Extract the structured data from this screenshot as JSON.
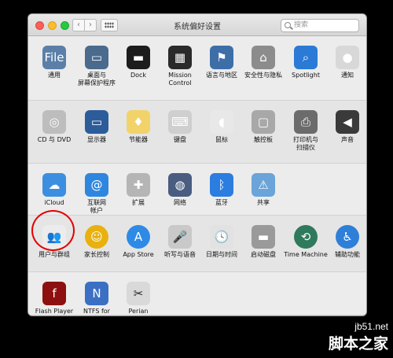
{
  "window": {
    "title": "系统偏好设置",
    "search_placeholder": "搜索",
    "nav_back": "‹",
    "nav_forward": "›"
  },
  "rows": [
    {
      "panes": [
        {
          "name": "pane-general",
          "label": "通用",
          "icon": "general-icon",
          "bg": "#5b7fa8",
          "glyph": "File"
        },
        {
          "name": "pane-desktop",
          "label": "桌面与",
          "label2": "屏幕保护程序",
          "icon": "desktop-icon",
          "bg": "#4a6a8e",
          "glyph": "▭"
        },
        {
          "name": "pane-dock",
          "label": "Dock",
          "icon": "dock-icon",
          "bg": "#1c1c1c",
          "glyph": "▬"
        },
        {
          "name": "pane-mission-control",
          "label": "Mission",
          "label2": "Control",
          "icon": "mission-control-icon",
          "bg": "#2a2a2a",
          "glyph": "▦"
        },
        {
          "name": "pane-language",
          "label": "语言与地区",
          "icon": "flag-icon",
          "bg": "#3d6ea8",
          "glyph": "⚑"
        },
        {
          "name": "pane-security",
          "label": "安全性与隐私",
          "icon": "house-lock-icon",
          "bg": "#8c8c8c",
          "glyph": "⌂"
        },
        {
          "name": "pane-spotlight",
          "label": "Spotlight",
          "icon": "spotlight-icon",
          "bg": "#2a7ad6",
          "glyph": "⌕"
        },
        {
          "name": "pane-notifications",
          "label": "通知",
          "icon": "notifications-icon",
          "bg": "#d8d8d8",
          "glyph": "●"
        }
      ]
    },
    {
      "panes": [
        {
          "name": "pane-cd-dvd",
          "label": "CD 与 DVD",
          "icon": "disc-icon",
          "bg": "#bdbdbd",
          "glyph": "◎"
        },
        {
          "name": "pane-displays",
          "label": "显示器",
          "icon": "display-icon",
          "bg": "#2c5d9a",
          "glyph": "▭"
        },
        {
          "name": "pane-energy",
          "label": "节能器",
          "icon": "lightbulb-icon",
          "bg": "#f1d36a",
          "glyph": "♦"
        },
        {
          "name": "pane-keyboard",
          "label": "键盘",
          "icon": "keyboard-icon",
          "bg": "#cfcfcf",
          "glyph": "⌨"
        },
        {
          "name": "pane-mouse",
          "label": "鼠标",
          "icon": "mouse-icon",
          "bg": "#e8e8e8",
          "glyph": "◖"
        },
        {
          "name": "pane-trackpad",
          "label": "触控板",
          "icon": "trackpad-icon",
          "bg": "#a8a8a8",
          "glyph": "▢"
        },
        {
          "name": "pane-printers",
          "label": "打印机与",
          "label2": "扫描仪",
          "icon": "printer-icon",
          "bg": "#6b6b6b",
          "glyph": "⎙"
        },
        {
          "name": "pane-sound",
          "label": "声音",
          "icon": "speaker-icon",
          "bg": "#3a3a3a",
          "glyph": "◀"
        }
      ]
    },
    {
      "panes": [
        {
          "name": "pane-icloud",
          "label": "iCloud",
          "icon": "cloud-icon",
          "bg": "#3c8fe0",
          "glyph": "☁"
        },
        {
          "name": "pane-internet-accounts",
          "label": "互联网",
          "label2": "帐户",
          "icon": "at-icon",
          "bg": "#2f86de",
          "glyph": "@"
        },
        {
          "name": "pane-extensions",
          "label": "扩展",
          "icon": "puzzle-icon",
          "bg": "#b5b5b5",
          "glyph": "✚"
        },
        {
          "name": "pane-network",
          "label": "网络",
          "icon": "globe-icon",
          "bg": "#4a5c80",
          "glyph": "◍"
        },
        {
          "name": "pane-bluetooth",
          "label": "蓝牙",
          "icon": "bluetooth-icon",
          "bg": "#2b7de0",
          "glyph": "ᛒ"
        },
        {
          "name": "pane-sharing",
          "label": "共享",
          "icon": "sharing-folder-icon",
          "bg": "#6aa4d8",
          "glyph": "⚠"
        }
      ]
    },
    {
      "panes": [
        {
          "name": "pane-users-groups",
          "label": "用户与群组",
          "icon": "users-icon",
          "bg": "#ececec",
          "glyph": "👥",
          "dark": true
        },
        {
          "name": "pane-parental-controls",
          "label": "家长控制",
          "icon": "parental-controls-icon",
          "bg": "#e8b10f",
          "glyph": "☺",
          "round": true
        },
        {
          "name": "pane-app-store",
          "label": "App Store",
          "icon": "app-store-icon",
          "bg": "#2f8ae6",
          "glyph": "A",
          "round": true
        },
        {
          "name": "pane-dictation",
          "label": "听写与语音",
          "icon": "microphone-icon",
          "bg": "#c9c9c9",
          "glyph": "🎤"
        },
        {
          "name": "pane-date-time",
          "label": "日期与时间",
          "icon": "clock-icon",
          "bg": "#e2e2e2",
          "glyph": "🕓",
          "dark": true
        },
        {
          "name": "pane-startup-disk",
          "label": "启动磁盘",
          "icon": "disk-icon",
          "bg": "#9a9a9a",
          "glyph": "▬"
        },
        {
          "name": "pane-time-machine",
          "label": "Time Machine",
          "icon": "time-machine-icon",
          "bg": "#2f7a5c",
          "glyph": "⟲",
          "round": true
        },
        {
          "name": "pane-accessibility",
          "label": "辅助功能",
          "icon": "accessibility-icon",
          "bg": "#2e7fd8",
          "glyph": "♿",
          "round": true
        }
      ]
    },
    {
      "panes": [
        {
          "name": "pane-flash-player",
          "label": "Flash Player",
          "icon": "flash-icon",
          "bg": "#8e0f0f",
          "glyph": "f"
        },
        {
          "name": "pane-ntfs",
          "label": "NTFS for",
          "label2": "Mac OS X",
          "icon": "ntfs-icon",
          "bg": "#3b6fc4",
          "glyph": "N"
        },
        {
          "name": "pane-perian",
          "label": "Perian",
          "icon": "knife-icon",
          "bg": "#d9d9d9",
          "glyph": "✂",
          "dark": true
        }
      ]
    }
  ],
  "watermark": {
    "url": "jb51.net",
    "name": "脚本之家"
  }
}
